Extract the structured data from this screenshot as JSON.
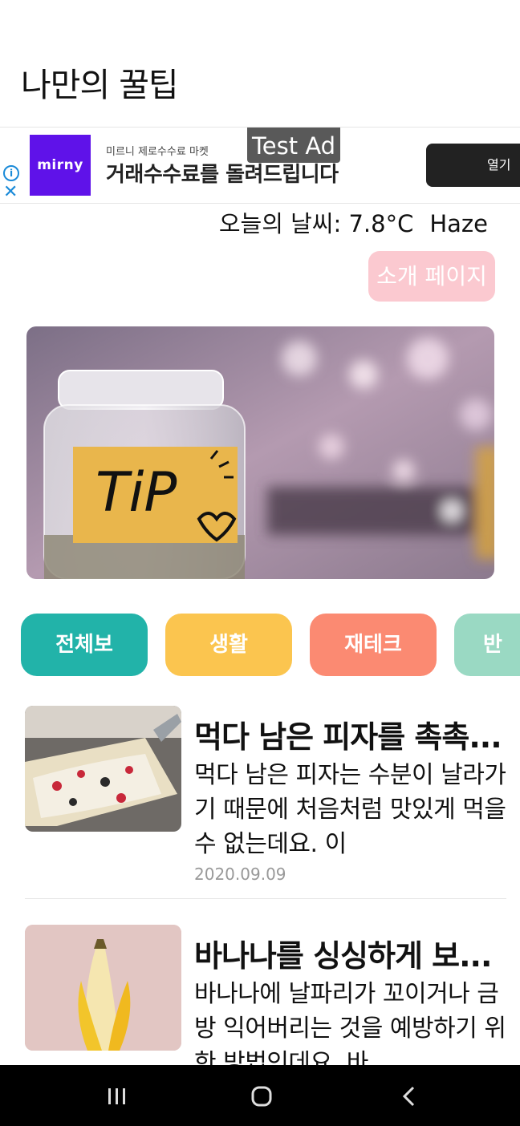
{
  "header": {
    "title": "나만의 꿀팁"
  },
  "ad": {
    "tag": "Test Ad",
    "logo_text": "mirny",
    "subtitle": "미르니 제로수수료 마켓",
    "headline": "거래수수료를 돌려드립니다",
    "cta": "열기",
    "info_icon": "info-icon",
    "close_icon": "close-icon"
  },
  "weather": {
    "label": "오늘의 날씨: 7.8°C",
    "condition": "Haze"
  },
  "intro_button": "소개 페이지",
  "hero": {
    "image": "tip-jar-photo",
    "jar_text": "TiP"
  },
  "categories": [
    {
      "label": "전체보",
      "color": "#22b3a9"
    },
    {
      "label": "생활",
      "color": "#fbc54f"
    },
    {
      "label": "재테크",
      "color": "#fb8a72"
    },
    {
      "label": "반려",
      "color": "#9ad9c3"
    }
  ],
  "articles": [
    {
      "title": "먹다 남은 피자를 촉촉하게",
      "body": "먹다 남은 피자는 수분이 날라가기 때문에 처음처럼 맛있게 먹을 수 없는데요. 이",
      "date": "2020.09.09",
      "image": "pizza-photo"
    },
    {
      "title": "바나나를 싱싱하게 보관하는 법",
      "body": "바나나에 날파리가 꼬이거나 금방 익어버리는 것을 예방하기 위한 방법인데요. 바",
      "date": "",
      "image": "banana-photo"
    }
  ],
  "navbar": {
    "recent": "recent-apps-icon",
    "home": "home-icon",
    "back": "back-icon"
  }
}
